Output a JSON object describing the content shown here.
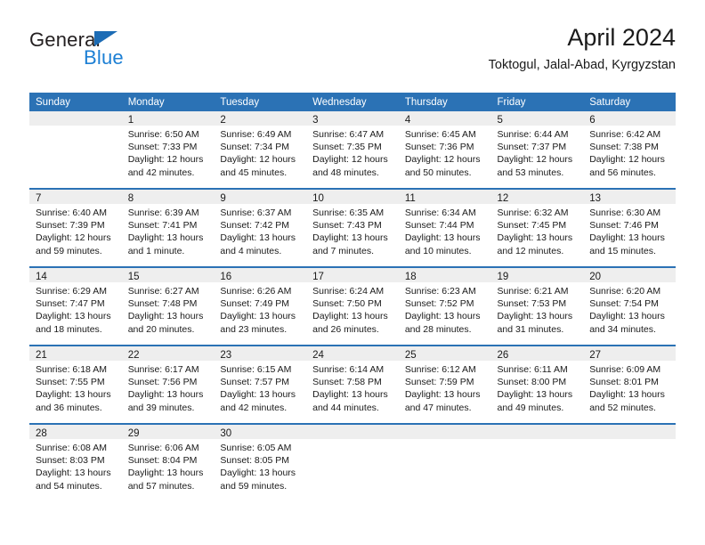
{
  "logo": {
    "line1": "General",
    "line2": "Blue",
    "triangle_icon": "logo-triangle-icon",
    "color_dark": "#231f20",
    "color_blue": "#1c7fd4"
  },
  "header": {
    "title": "April 2024",
    "subtitle": "Toktogul, Jalal-Abad, Kyrgyzstan"
  },
  "theme": {
    "header_blue": "#2b72b5",
    "daynum_gray": "#eeeeee"
  },
  "calendar": {
    "weekday_headers": [
      "Sunday",
      "Monday",
      "Tuesday",
      "Wednesday",
      "Thursday",
      "Friday",
      "Saturday"
    ],
    "weeks": [
      [
        {
          "day": "",
          "lines": []
        },
        {
          "day": "1",
          "lines": [
            "Sunrise: 6:50 AM",
            "Sunset: 7:33 PM",
            "Daylight: 12 hours",
            "and 42 minutes."
          ]
        },
        {
          "day": "2",
          "lines": [
            "Sunrise: 6:49 AM",
            "Sunset: 7:34 PM",
            "Daylight: 12 hours",
            "and 45 minutes."
          ]
        },
        {
          "day": "3",
          "lines": [
            "Sunrise: 6:47 AM",
            "Sunset: 7:35 PM",
            "Daylight: 12 hours",
            "and 48 minutes."
          ]
        },
        {
          "day": "4",
          "lines": [
            "Sunrise: 6:45 AM",
            "Sunset: 7:36 PM",
            "Daylight: 12 hours",
            "and 50 minutes."
          ]
        },
        {
          "day": "5",
          "lines": [
            "Sunrise: 6:44 AM",
            "Sunset: 7:37 PM",
            "Daylight: 12 hours",
            "and 53 minutes."
          ]
        },
        {
          "day": "6",
          "lines": [
            "Sunrise: 6:42 AM",
            "Sunset: 7:38 PM",
            "Daylight: 12 hours",
            "and 56 minutes."
          ]
        }
      ],
      [
        {
          "day": "7",
          "lines": [
            "Sunrise: 6:40 AM",
            "Sunset: 7:39 PM",
            "Daylight: 12 hours",
            "and 59 minutes."
          ]
        },
        {
          "day": "8",
          "lines": [
            "Sunrise: 6:39 AM",
            "Sunset: 7:41 PM",
            "Daylight: 13 hours",
            "and 1 minute."
          ]
        },
        {
          "day": "9",
          "lines": [
            "Sunrise: 6:37 AM",
            "Sunset: 7:42 PM",
            "Daylight: 13 hours",
            "and 4 minutes."
          ]
        },
        {
          "day": "10",
          "lines": [
            "Sunrise: 6:35 AM",
            "Sunset: 7:43 PM",
            "Daylight: 13 hours",
            "and 7 minutes."
          ]
        },
        {
          "day": "11",
          "lines": [
            "Sunrise: 6:34 AM",
            "Sunset: 7:44 PM",
            "Daylight: 13 hours",
            "and 10 minutes."
          ]
        },
        {
          "day": "12",
          "lines": [
            "Sunrise: 6:32 AM",
            "Sunset: 7:45 PM",
            "Daylight: 13 hours",
            "and 12 minutes."
          ]
        },
        {
          "day": "13",
          "lines": [
            "Sunrise: 6:30 AM",
            "Sunset: 7:46 PM",
            "Daylight: 13 hours",
            "and 15 minutes."
          ]
        }
      ],
      [
        {
          "day": "14",
          "lines": [
            "Sunrise: 6:29 AM",
            "Sunset: 7:47 PM",
            "Daylight: 13 hours",
            "and 18 minutes."
          ]
        },
        {
          "day": "15",
          "lines": [
            "Sunrise: 6:27 AM",
            "Sunset: 7:48 PM",
            "Daylight: 13 hours",
            "and 20 minutes."
          ]
        },
        {
          "day": "16",
          "lines": [
            "Sunrise: 6:26 AM",
            "Sunset: 7:49 PM",
            "Daylight: 13 hours",
            "and 23 minutes."
          ]
        },
        {
          "day": "17",
          "lines": [
            "Sunrise: 6:24 AM",
            "Sunset: 7:50 PM",
            "Daylight: 13 hours",
            "and 26 minutes."
          ]
        },
        {
          "day": "18",
          "lines": [
            "Sunrise: 6:23 AM",
            "Sunset: 7:52 PM",
            "Daylight: 13 hours",
            "and 28 minutes."
          ]
        },
        {
          "day": "19",
          "lines": [
            "Sunrise: 6:21 AM",
            "Sunset: 7:53 PM",
            "Daylight: 13 hours",
            "and 31 minutes."
          ]
        },
        {
          "day": "20",
          "lines": [
            "Sunrise: 6:20 AM",
            "Sunset: 7:54 PM",
            "Daylight: 13 hours",
            "and 34 minutes."
          ]
        }
      ],
      [
        {
          "day": "21",
          "lines": [
            "Sunrise: 6:18 AM",
            "Sunset: 7:55 PM",
            "Daylight: 13 hours",
            "and 36 minutes."
          ]
        },
        {
          "day": "22",
          "lines": [
            "Sunrise: 6:17 AM",
            "Sunset: 7:56 PM",
            "Daylight: 13 hours",
            "and 39 minutes."
          ]
        },
        {
          "day": "23",
          "lines": [
            "Sunrise: 6:15 AM",
            "Sunset: 7:57 PM",
            "Daylight: 13 hours",
            "and 42 minutes."
          ]
        },
        {
          "day": "24",
          "lines": [
            "Sunrise: 6:14 AM",
            "Sunset: 7:58 PM",
            "Daylight: 13 hours",
            "and 44 minutes."
          ]
        },
        {
          "day": "25",
          "lines": [
            "Sunrise: 6:12 AM",
            "Sunset: 7:59 PM",
            "Daylight: 13 hours",
            "and 47 minutes."
          ]
        },
        {
          "day": "26",
          "lines": [
            "Sunrise: 6:11 AM",
            "Sunset: 8:00 PM",
            "Daylight: 13 hours",
            "and 49 minutes."
          ]
        },
        {
          "day": "27",
          "lines": [
            "Sunrise: 6:09 AM",
            "Sunset: 8:01 PM",
            "Daylight: 13 hours",
            "and 52 minutes."
          ]
        }
      ],
      [
        {
          "day": "28",
          "lines": [
            "Sunrise: 6:08 AM",
            "Sunset: 8:03 PM",
            "Daylight: 13 hours",
            "and 54 minutes."
          ]
        },
        {
          "day": "29",
          "lines": [
            "Sunrise: 6:06 AM",
            "Sunset: 8:04 PM",
            "Daylight: 13 hours",
            "and 57 minutes."
          ]
        },
        {
          "day": "30",
          "lines": [
            "Sunrise: 6:05 AM",
            "Sunset: 8:05 PM",
            "Daylight: 13 hours",
            "and 59 minutes."
          ]
        },
        {
          "day": "",
          "lines": []
        },
        {
          "day": "",
          "lines": []
        },
        {
          "day": "",
          "lines": []
        },
        {
          "day": "",
          "lines": []
        }
      ]
    ]
  }
}
